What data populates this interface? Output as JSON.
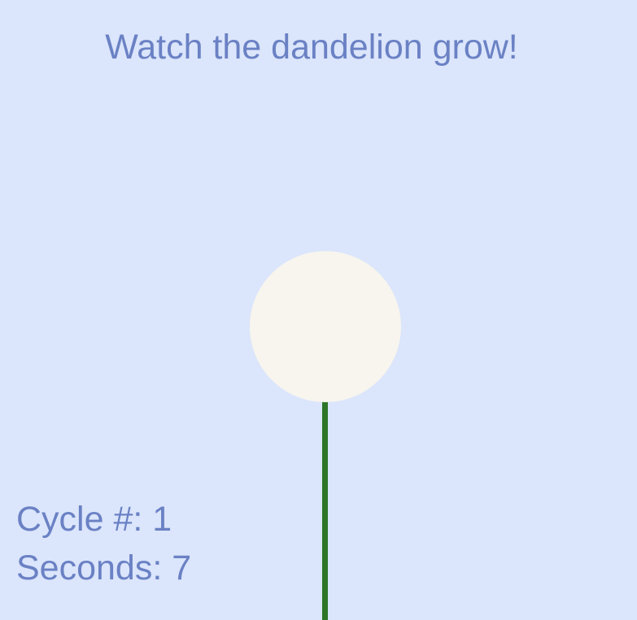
{
  "title": "Watch the dandelion grow!",
  "hud": {
    "cycle_label": "Cycle #:",
    "cycle_value": "1",
    "seconds_label": "Seconds:",
    "seconds_value": "7"
  },
  "colors": {
    "background": "#dbe5fb",
    "text": "#6a81c4",
    "stem": "#2e7528",
    "seed_head": "#f7f5ee"
  },
  "icons": {
    "flower_head": "dandelion-seed-head",
    "flower_stem": "dandelion-stem"
  }
}
